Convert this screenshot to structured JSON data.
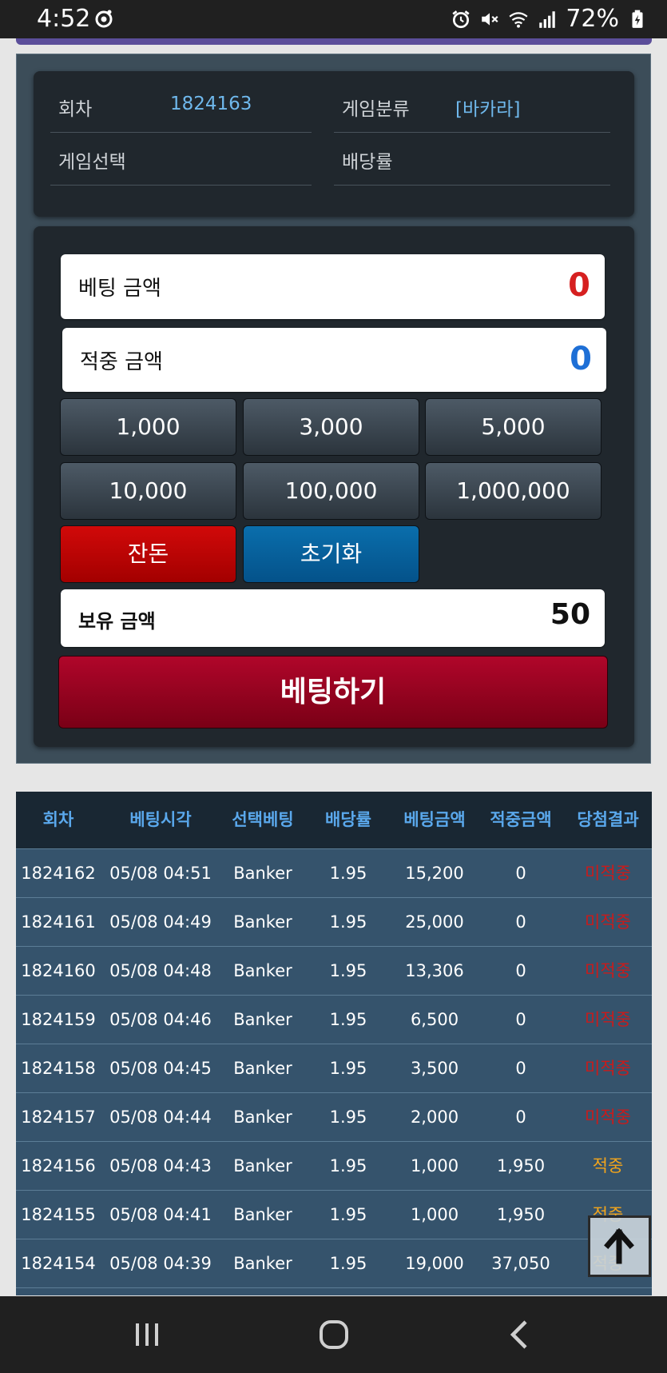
{
  "status_bar": {
    "time": "4:52",
    "battery_percent": "72%",
    "icons": [
      "record-icon",
      "alarm-icon",
      "mute-icon",
      "wifi-icon",
      "signal-icon",
      "battery-icon"
    ]
  },
  "game_info": {
    "round_label": "회차",
    "round_value": "1824163",
    "category_label": "게임분류",
    "category_value": "[바카라]",
    "select_label": "게임선택",
    "select_value": "",
    "odds_label": "배당률",
    "odds_value": ""
  },
  "bet_panel": {
    "bet_amount_label": "베팅 금액",
    "bet_amount_value": "0",
    "win_amount_label": "적중 금액",
    "win_amount_value": "0",
    "chips": [
      "1,000",
      "3,000",
      "5,000",
      "10,000",
      "100,000",
      "1,000,000"
    ],
    "change_label": "잔돈",
    "reset_label": "초기화",
    "balance_label": "보유 금액",
    "balance_value": "50",
    "submit_label": "베팅하기",
    "colors": {
      "bet_amount": "#d62020",
      "win_amount": "#1e6fd6",
      "change_button": "#c10404",
      "reset_button": "#075f9b",
      "submit_button": "#9d0424"
    }
  },
  "history": {
    "columns": [
      "회차",
      "베팅시각",
      "선택베팅",
      "배당률",
      "베팅금액",
      "적중금액",
      "당첨결과"
    ],
    "rows": [
      {
        "round": "1824162",
        "time": "05/08 04:51",
        "pick": "Banker",
        "odds": "1.95",
        "bet": "15,200",
        "win": "0",
        "result": "미적중",
        "status": "miss"
      },
      {
        "round": "1824161",
        "time": "05/08 04:49",
        "pick": "Banker",
        "odds": "1.95",
        "bet": "25,000",
        "win": "0",
        "result": "미적중",
        "status": "miss"
      },
      {
        "round": "1824160",
        "time": "05/08 04:48",
        "pick": "Banker",
        "odds": "1.95",
        "bet": "13,306",
        "win": "0",
        "result": "미적중",
        "status": "miss"
      },
      {
        "round": "1824159",
        "time": "05/08 04:46",
        "pick": "Banker",
        "odds": "1.95",
        "bet": "6,500",
        "win": "0",
        "result": "미적중",
        "status": "miss"
      },
      {
        "round": "1824158",
        "time": "05/08 04:45",
        "pick": "Banker",
        "odds": "1.95",
        "bet": "3,500",
        "win": "0",
        "result": "미적중",
        "status": "miss"
      },
      {
        "round": "1824157",
        "time": "05/08 04:44",
        "pick": "Banker",
        "odds": "1.95",
        "bet": "2,000",
        "win": "0",
        "result": "미적중",
        "status": "miss"
      },
      {
        "round": "1824156",
        "time": "05/08 04:43",
        "pick": "Banker",
        "odds": "1.95",
        "bet": "1,000",
        "win": "1,950",
        "result": "적중",
        "status": "hit"
      },
      {
        "round": "1824155",
        "time": "05/08 04:41",
        "pick": "Banker",
        "odds": "1.95",
        "bet": "1,000",
        "win": "1,950",
        "result": "적중",
        "status": "hit"
      },
      {
        "round": "1824154",
        "time": "05/08 04:39",
        "pick": "Banker",
        "odds": "1.95",
        "bet": "19,000",
        "win": "37,050",
        "result": "적중",
        "status": "hit"
      }
    ]
  },
  "nav_bar": {
    "icons": [
      "recent-apps-icon",
      "home-icon",
      "back-icon"
    ]
  }
}
